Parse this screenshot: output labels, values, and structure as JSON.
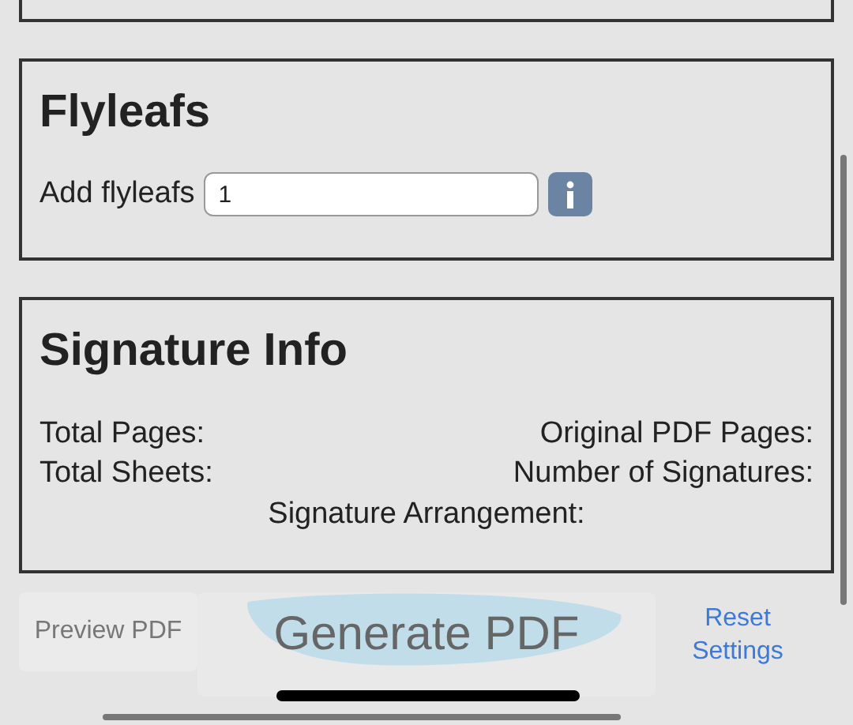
{
  "flyleafs": {
    "title": "Flyleafs",
    "label": "Add flyleafs",
    "value": "1"
  },
  "signature_info": {
    "title": "Signature Info",
    "total_pages": "Total Pages:",
    "original_pdf_pages": "Original PDF Pages:",
    "total_sheets": "Total Sheets:",
    "number_of_signatures": "Number of Signatures:",
    "signature_arrangement": "Signature Arrangement:"
  },
  "toolbar": {
    "preview": "Preview PDF",
    "generate": "Generate PDF",
    "reset": "Reset Settings"
  }
}
